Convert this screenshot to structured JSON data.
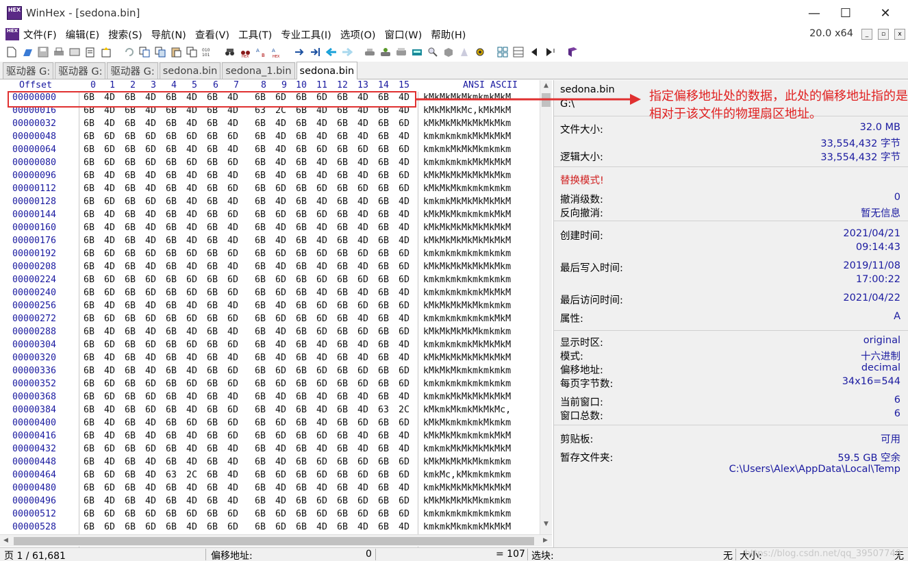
{
  "window": {
    "title": "WinHex - [sedona.bin]",
    "logo_text": "HEX",
    "minimize": "—",
    "maximize": "☐",
    "close": "✕"
  },
  "menu": {
    "items": [
      "文件(F)",
      "编辑(E)",
      "搜索(S)",
      "导航(N)",
      "查看(V)",
      "工具(T)",
      "专业工具(I)",
      "选项(O)",
      "窗口(W)",
      "帮助(H)"
    ],
    "version": "20.0 x64"
  },
  "tabs": [
    "驱动器 G:",
    "驱动器 G:",
    "驱动器 G:",
    "sedona.bin",
    "sedona_1.bin",
    "sedona.bin"
  ],
  "hex": {
    "offset_header": "Offset",
    "col_headers": [
      "0",
      "1",
      "2",
      "3",
      "4",
      "5",
      "6",
      "7",
      "8",
      "9",
      "10",
      "11",
      "12",
      "13",
      "14",
      "15"
    ],
    "ascii_header": "ANSI ASCII",
    "rows": [
      {
        "off": "00000000",
        "bytes": [
          "6B",
          "4D",
          "6B",
          "4D",
          "6B",
          "4D",
          "6B",
          "4D",
          "6B",
          "6D",
          "6B",
          "6D",
          "6B",
          "4D",
          "6B",
          "4D"
        ],
        "ascii": "kMkMkMkMkmkmkMkM"
      },
      {
        "off": "00000016",
        "bytes": [
          "6B",
          "4D",
          "6B",
          "4D",
          "6B",
          "4D",
          "6B",
          "4D",
          "63",
          "2C",
          "6B",
          "4D",
          "6B",
          "4D",
          "6B",
          "4D"
        ],
        "ascii": "kMkMkMkMc,kMkMkM"
      },
      {
        "off": "00000032",
        "bytes": [
          "6B",
          "4D",
          "6B",
          "4D",
          "6B",
          "4D",
          "6B",
          "4D",
          "6B",
          "4D",
          "6B",
          "4D",
          "6B",
          "4D",
          "6B",
          "6D"
        ],
        "ascii": "kMkMkMkMkMkMkMkm"
      },
      {
        "off": "00000048",
        "bytes": [
          "6B",
          "6D",
          "6B",
          "6D",
          "6B",
          "6D",
          "6B",
          "6D",
          "6B",
          "4D",
          "6B",
          "4D",
          "6B",
          "4D",
          "6B",
          "4D"
        ],
        "ascii": "kmkmkmkmkMkMkMkM"
      },
      {
        "off": "00000064",
        "bytes": [
          "6B",
          "6D",
          "6B",
          "6D",
          "6B",
          "4D",
          "6B",
          "4D",
          "6B",
          "4D",
          "6B",
          "6D",
          "6B",
          "6D",
          "6B",
          "6D"
        ],
        "ascii": "kmkmkMkMkMkmkmkm"
      },
      {
        "off": "00000080",
        "bytes": [
          "6B",
          "6D",
          "6B",
          "6D",
          "6B",
          "6D",
          "6B",
          "6D",
          "6B",
          "4D",
          "6B",
          "4D",
          "6B",
          "4D",
          "6B",
          "4D"
        ],
        "ascii": "kmkmkmkmkMkMkMkM"
      },
      {
        "off": "00000096",
        "bytes": [
          "6B",
          "4D",
          "6B",
          "4D",
          "6B",
          "4D",
          "6B",
          "4D",
          "6B",
          "4D",
          "6B",
          "4D",
          "6B",
          "4D",
          "6B",
          "6D"
        ],
        "ascii": "kMkMkMkMkMkMkMkm"
      },
      {
        "off": "00000112",
        "bytes": [
          "6B",
          "4D",
          "6B",
          "4D",
          "6B",
          "4D",
          "6B",
          "6D",
          "6B",
          "6D",
          "6B",
          "6D",
          "6B",
          "6D",
          "6B",
          "6D"
        ],
        "ascii": "kMkMkMkmkmkmkmkm"
      },
      {
        "off": "00000128",
        "bytes": [
          "6B",
          "6D",
          "6B",
          "6D",
          "6B",
          "4D",
          "6B",
          "4D",
          "6B",
          "4D",
          "6B",
          "4D",
          "6B",
          "4D",
          "6B",
          "4D"
        ],
        "ascii": "kmkmkMkMkMkMkMkM"
      },
      {
        "off": "00000144",
        "bytes": [
          "6B",
          "4D",
          "6B",
          "4D",
          "6B",
          "4D",
          "6B",
          "6D",
          "6B",
          "6D",
          "6B",
          "6D",
          "6B",
          "4D",
          "6B",
          "4D"
        ],
        "ascii": "kMkMkMkmkmkmkMkM"
      },
      {
        "off": "00000160",
        "bytes": [
          "6B",
          "4D",
          "6B",
          "4D",
          "6B",
          "4D",
          "6B",
          "4D",
          "6B",
          "4D",
          "6B",
          "4D",
          "6B",
          "4D",
          "6B",
          "4D"
        ],
        "ascii": "kMkMkMkMkMkMkMkM"
      },
      {
        "off": "00000176",
        "bytes": [
          "6B",
          "4D",
          "6B",
          "4D",
          "6B",
          "4D",
          "6B",
          "4D",
          "6B",
          "4D",
          "6B",
          "4D",
          "6B",
          "4D",
          "6B",
          "4D"
        ],
        "ascii": "kMkMkMkMkMkMkMkM"
      },
      {
        "off": "00000192",
        "bytes": [
          "6B",
          "6D",
          "6B",
          "6D",
          "6B",
          "6D",
          "6B",
          "6D",
          "6B",
          "6D",
          "6B",
          "6D",
          "6B",
          "6D",
          "6B",
          "6D"
        ],
        "ascii": "kmkmkmkmkmkmkmkm"
      },
      {
        "off": "00000208",
        "bytes": [
          "6B",
          "4D",
          "6B",
          "4D",
          "6B",
          "4D",
          "6B",
          "4D",
          "6B",
          "4D",
          "6B",
          "4D",
          "6B",
          "4D",
          "6B",
          "6D"
        ],
        "ascii": "kMkMkMkMkMkMkMkm"
      },
      {
        "off": "00000224",
        "bytes": [
          "6B",
          "6D",
          "6B",
          "6D",
          "6B",
          "6D",
          "6B",
          "6D",
          "6B",
          "6D",
          "6B",
          "6D",
          "6B",
          "6D",
          "6B",
          "6D"
        ],
        "ascii": "kmkmkmkmkmkmkmkm"
      },
      {
        "off": "00000240",
        "bytes": [
          "6B",
          "6D",
          "6B",
          "6D",
          "6B",
          "6D",
          "6B",
          "6D",
          "6B",
          "6D",
          "6B",
          "4D",
          "6B",
          "4D",
          "6B",
          "4D"
        ],
        "ascii": "kmkmkmkmkmkMkMkM"
      },
      {
        "off": "00000256",
        "bytes": [
          "6B",
          "4D",
          "6B",
          "4D",
          "6B",
          "4D",
          "6B",
          "4D",
          "6B",
          "4D",
          "6B",
          "6D",
          "6B",
          "6D",
          "6B",
          "6D"
        ],
        "ascii": "kMkMkMkMkMkmkmkm"
      },
      {
        "off": "00000272",
        "bytes": [
          "6B",
          "6D",
          "6B",
          "6D",
          "6B",
          "6D",
          "6B",
          "6D",
          "6B",
          "6D",
          "6B",
          "6D",
          "6B",
          "4D",
          "6B",
          "4D"
        ],
        "ascii": "kmkmkmkmkmkmkMkM"
      },
      {
        "off": "00000288",
        "bytes": [
          "6B",
          "4D",
          "6B",
          "4D",
          "6B",
          "4D",
          "6B",
          "4D",
          "6B",
          "4D",
          "6B",
          "6D",
          "6B",
          "6D",
          "6B",
          "6D"
        ],
        "ascii": "kMkMkMkMkMkmkmkm"
      },
      {
        "off": "00000304",
        "bytes": [
          "6B",
          "6D",
          "6B",
          "6D",
          "6B",
          "6D",
          "6B",
          "6D",
          "6B",
          "4D",
          "6B",
          "4D",
          "6B",
          "4D",
          "6B",
          "4D"
        ],
        "ascii": "kmkmkmkmkMkMkMkM"
      },
      {
        "off": "00000320",
        "bytes": [
          "6B",
          "4D",
          "6B",
          "4D",
          "6B",
          "4D",
          "6B",
          "4D",
          "6B",
          "4D",
          "6B",
          "4D",
          "6B",
          "4D",
          "6B",
          "4D"
        ],
        "ascii": "kMkMkMkMkMkMkMkM"
      },
      {
        "off": "00000336",
        "bytes": [
          "6B",
          "4D",
          "6B",
          "4D",
          "6B",
          "4D",
          "6B",
          "6D",
          "6B",
          "6D",
          "6B",
          "6D",
          "6B",
          "6D",
          "6B",
          "6D"
        ],
        "ascii": "kMkMkMkmkmkmkmkm"
      },
      {
        "off": "00000352",
        "bytes": [
          "6B",
          "6D",
          "6B",
          "6D",
          "6B",
          "6D",
          "6B",
          "6D",
          "6B",
          "6D",
          "6B",
          "6D",
          "6B",
          "6D",
          "6B",
          "6D"
        ],
        "ascii": "kmkmkmkmkmkmkmkm"
      },
      {
        "off": "00000368",
        "bytes": [
          "6B",
          "6D",
          "6B",
          "6D",
          "6B",
          "4D",
          "6B",
          "4D",
          "6B",
          "4D",
          "6B",
          "4D",
          "6B",
          "4D",
          "6B",
          "4D"
        ],
        "ascii": "kmkmkMkMkMkMkMkM"
      },
      {
        "off": "00000384",
        "bytes": [
          "6B",
          "4D",
          "6B",
          "6D",
          "6B",
          "4D",
          "6B",
          "6D",
          "6B",
          "4D",
          "6B",
          "4D",
          "6B",
          "4D",
          "63",
          "2C"
        ],
        "ascii": "kMkmkMkmkMkMkMc,"
      },
      {
        "off": "00000400",
        "bytes": [
          "6B",
          "4D",
          "6B",
          "4D",
          "6B",
          "6D",
          "6B",
          "6D",
          "6B",
          "6D",
          "6B",
          "4D",
          "6B",
          "6D",
          "6B",
          "6D"
        ],
        "ascii": "kMkMkmkmkmkMkmkm"
      },
      {
        "off": "00000416",
        "bytes": [
          "6B",
          "4D",
          "6B",
          "4D",
          "6B",
          "4D",
          "6B",
          "6D",
          "6B",
          "6D",
          "6B",
          "6D",
          "6B",
          "4D",
          "6B",
          "4D"
        ],
        "ascii": "kMkMkMkmkmkmkMkM"
      },
      {
        "off": "00000432",
        "bytes": [
          "6B",
          "6D",
          "6B",
          "6D",
          "6B",
          "4D",
          "6B",
          "4D",
          "6B",
          "4D",
          "6B",
          "4D",
          "6B",
          "4D",
          "6B",
          "4D"
        ],
        "ascii": "kmkmkMkMkMkMkMkM"
      },
      {
        "off": "00000448",
        "bytes": [
          "6B",
          "4D",
          "6B",
          "4D",
          "6B",
          "4D",
          "6B",
          "4D",
          "6B",
          "4D",
          "6B",
          "6D",
          "6B",
          "6D",
          "6B",
          "6D"
        ],
        "ascii": "kMkMkMkMkMkmkmkm"
      },
      {
        "off": "00000464",
        "bytes": [
          "6B",
          "6D",
          "6B",
          "4D",
          "63",
          "2C",
          "6B",
          "4D",
          "6B",
          "6D",
          "6B",
          "6D",
          "6B",
          "6D",
          "6B",
          "6D"
        ],
        "ascii": "kmkMc,kMkmkmkmkm"
      },
      {
        "off": "00000480",
        "bytes": [
          "6B",
          "6D",
          "6B",
          "4D",
          "6B",
          "4D",
          "6B",
          "4D",
          "6B",
          "4D",
          "6B",
          "4D",
          "6B",
          "4D",
          "6B",
          "4D"
        ],
        "ascii": "kmkMkMkMkMkMkMkM"
      },
      {
        "off": "00000496",
        "bytes": [
          "6B",
          "4D",
          "6B",
          "4D",
          "6B",
          "4D",
          "6B",
          "4D",
          "6B",
          "4D",
          "6B",
          "6D",
          "6B",
          "6D",
          "6B",
          "6D"
        ],
        "ascii": "kMkMkMkMkMkmkmkm"
      },
      {
        "off": "00000512",
        "bytes": [
          "6B",
          "6D",
          "6B",
          "6D",
          "6B",
          "6D",
          "6B",
          "6D",
          "6B",
          "6D",
          "6B",
          "6D",
          "6B",
          "6D",
          "6B",
          "6D"
        ],
        "ascii": "kmkmkmkmkmkmkmkm"
      },
      {
        "off": "00000528",
        "bytes": [
          "6B",
          "6D",
          "6B",
          "6D",
          "6B",
          "4D",
          "6B",
          "6D",
          "6B",
          "6D",
          "6B",
          "4D",
          "6B",
          "4D",
          "6B",
          "4D"
        ],
        "ascii": "kmkmkMkmkmkMkMkM"
      }
    ]
  },
  "info": {
    "filename": "sedona.bin",
    "path": "G:\\",
    "file_size_label": "文件大小:",
    "file_size_mb": "32.0 MB",
    "file_size_bytes": "33,554,432 字节",
    "logical_size_label": "逻辑大小:",
    "logical_size": "33,554,432 字节",
    "mode_warning": "替换模式!",
    "undo_level_label": "撤消级数:",
    "undo_level": "0",
    "reverse_undo_label": "反向撤消:",
    "reverse_undo": "暂无信息",
    "created_label": "创建时间:",
    "created_date": "2021/04/21",
    "created_time": "09:14:43",
    "modified_label": "最后写入时间:",
    "modified_date": "2019/11/08",
    "modified_time": "17:00:22",
    "accessed_label": "最后访问时间:",
    "accessed_date": "2021/04/22",
    "attr_label": "属性:",
    "attr": "A",
    "timezone_label": "显示时区:",
    "timezone": "original",
    "mode_label": "模式:",
    "mode": "十六进制",
    "offset_label": "偏移地址:",
    "offset_mode": "decimal",
    "bytes_per_page_label": "每页字节数:",
    "bytes_per_page": "34x16=544",
    "current_window_label": "当前窗口:",
    "current_window": "6",
    "total_windows_label": "窗口总数:",
    "total_windows": "6",
    "clipboard_label": "剪贴板:",
    "clipboard": "可用",
    "temp_label": "暂存文件夹:",
    "temp_free": "59.5 GB 空余",
    "temp_path": "C:\\Users\\Alex\\AppData\\Local\\Temp"
  },
  "annotation": {
    "text": "指定偏移地址处的数据，此处的偏移地址指的是相对于该文件的物理扇区地址。",
    "color": "#e02020"
  },
  "status": {
    "page": "页 1 / 61,681",
    "offset_label": "偏移地址:",
    "offset_value": "0",
    "equals": "= 107",
    "selection_label": "选块:",
    "selection_value": "无",
    "size_label": "大小:",
    "size_value": "无",
    "watermark": "https://blog.csdn.net/qq_39507748"
  }
}
